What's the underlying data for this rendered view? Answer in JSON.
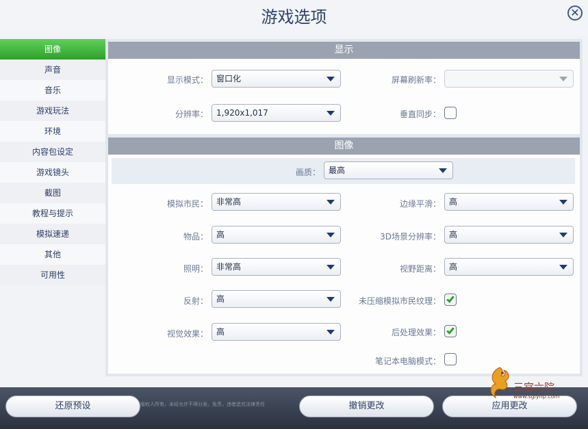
{
  "window": {
    "title": "游戏选项",
    "close_label": "✕"
  },
  "sidebar": {
    "items": [
      {
        "label": "图像",
        "active": true
      },
      {
        "label": "声音"
      },
      {
        "label": "音乐"
      },
      {
        "label": "游戏玩法"
      },
      {
        "label": "环境"
      },
      {
        "label": "内容包设定"
      },
      {
        "label": "游戏镜头"
      },
      {
        "label": "截图"
      },
      {
        "label": "教程与提示"
      },
      {
        "label": "模拟速递"
      },
      {
        "label": "其他"
      },
      {
        "label": "可用性"
      }
    ]
  },
  "display": {
    "header": "显示",
    "display_mode": {
      "label": "显示模式：",
      "value": "窗口化"
    },
    "refresh_rate": {
      "label": "屏幕刷新率：",
      "value": ""
    },
    "resolution": {
      "label": "分辨率：",
      "value": "1,920x1,017"
    },
    "vsync": {
      "label": "垂直同步：",
      "checked": false
    }
  },
  "graphics": {
    "header": "图像",
    "quality": {
      "label": "画质：",
      "value": "最高"
    },
    "sims": {
      "label": "模拟市民：",
      "value": "非常高"
    },
    "edge_smoothing": {
      "label": "边缘平滑：",
      "value": "高"
    },
    "objects": {
      "label": "物品：",
      "value": "高"
    },
    "scene_3d_res": {
      "label": "3D场景分辨率：",
      "value": "高"
    },
    "lighting": {
      "label": "照明：",
      "value": "非常高"
    },
    "view_distance": {
      "label": "视野距离：",
      "value": "高"
    },
    "reflections": {
      "label": "反射：",
      "value": "高"
    },
    "uncompressed_textures": {
      "label": "未压缩模拟市民纹理：",
      "checked": true
    },
    "visual_effects": {
      "label": "视觉效果：",
      "value": "高"
    },
    "post_processing": {
      "label": "后处理效果：",
      "checked": true
    },
    "laptop_mode": {
      "label": "笔记本电脑模式：",
      "checked": false
    }
  },
  "footer": {
    "restore_label": "还原预设",
    "cancel_label": "撤销更改",
    "apply_label": "应用更改",
    "note": "版权人所有，未经允许不得分发。免责，违者追究法律责任"
  },
  "watermark": {
    "text": "三宫六院",
    "url": "www.sglynp.com"
  },
  "colors": {
    "accent": "#2ea12a",
    "header": "#9ba3b1",
    "footer": "#2b3240"
  }
}
